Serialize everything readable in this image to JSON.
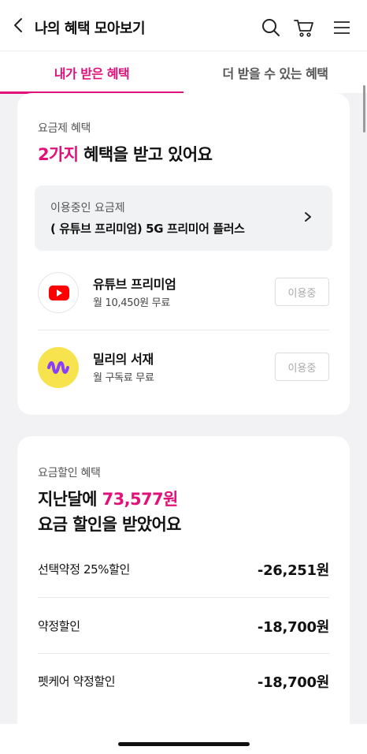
{
  "header": {
    "title": "나의 혜택 모아보기",
    "icons": [
      "back-arrow-icon",
      "search-icon",
      "cart-icon",
      "menu-icon"
    ]
  },
  "tabs": [
    {
      "label": "내가 받은 혜택",
      "active": true
    },
    {
      "label": "더 받을 수 있는 혜택",
      "active": false
    }
  ],
  "plan_benefits": {
    "caption": "요금제 혜택",
    "count_highlight": "2가지",
    "headline_rest": " 혜택을 받고 있어요",
    "current_plan": {
      "label": "이용중인 요금제",
      "name": "( 유튜브 프리미엄) 5G 프리미어 플러스"
    },
    "items": [
      {
        "name": "유튜브 프리미엄",
        "desc": "월 10,450원 무료",
        "status": "이용중",
        "icon": "youtube-icon"
      },
      {
        "name": "밀리의 서재",
        "desc": "월 구독료 무료",
        "status": "이용중",
        "icon": "millie-icon"
      }
    ]
  },
  "discount_benefits": {
    "caption": "요금할인 혜택",
    "headline_prefix": "지난달에 ",
    "amount": "73,577원",
    "headline_line2": "요금 할인을 받았어요",
    "rows": [
      {
        "label": "선택약정 25%할인",
        "value": "-26,251원"
      },
      {
        "label": "약정할인",
        "value": "-18,700원"
      },
      {
        "label": "펫케어 약정할인",
        "value": "-18,700원"
      }
    ]
  },
  "colors": {
    "accent": "#e0127a",
    "background": "#f2f2f4",
    "youtube_red": "#ff0000",
    "millie_yellow": "#f6e34d",
    "millie_purple": "#8a3ffc"
  }
}
